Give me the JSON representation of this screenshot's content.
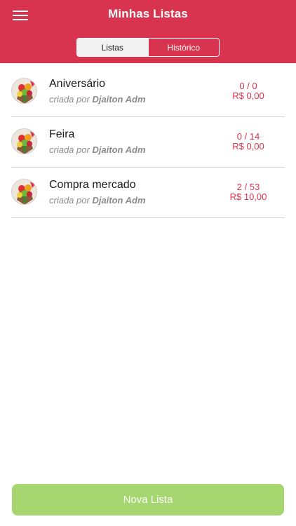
{
  "header": {
    "title": "Minhas Listas",
    "menu_icon": "hamburger-menu-icon",
    "background_color": "#d9344f"
  },
  "tabs": [
    {
      "label": "Listas",
      "selected": true
    },
    {
      "label": "Histórico",
      "selected": false
    }
  ],
  "lists": [
    {
      "name": "Aniversário",
      "created_by_prefix": "criada por",
      "author": "Djaiton Adm",
      "count": "0 / 0",
      "price": "R$ 0,00",
      "avatar_icon": "groceries-photo-icon"
    },
    {
      "name": "Feira",
      "created_by_prefix": "criada por",
      "author": "Djaiton Adm",
      "count": "0 / 14",
      "price": "R$ 0,00",
      "avatar_icon": "groceries-photo-icon"
    },
    {
      "name": "Compra mercado",
      "created_by_prefix": "criada por",
      "author": "Djaiton Adm",
      "count": "2 / 53",
      "price": "R$ 10,00",
      "avatar_icon": "groceries-photo-icon"
    }
  ],
  "footer": {
    "new_list_label": "Nova Lista",
    "button_color": "#a6d670"
  }
}
